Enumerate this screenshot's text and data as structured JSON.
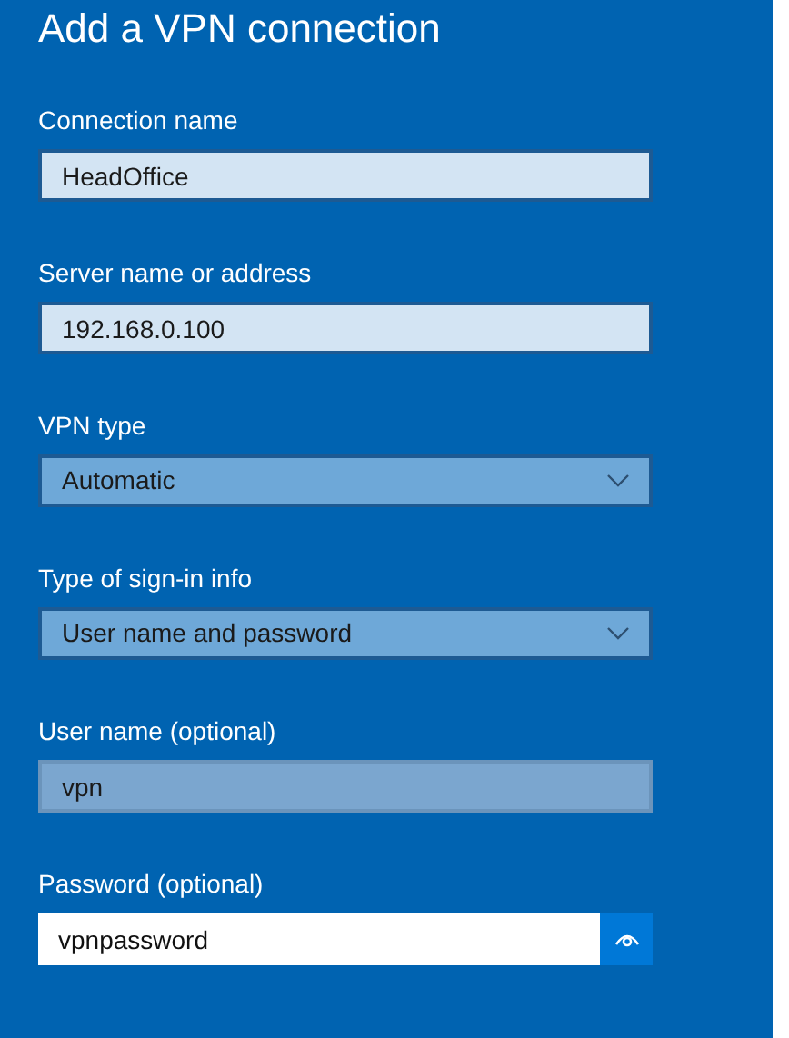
{
  "title": "Add a VPN connection",
  "fields": [
    {
      "label": "Connection name",
      "kind": "text",
      "value": "HeadOffice",
      "highlighted": false,
      "focused": false
    },
    {
      "label": "Server name or address",
      "kind": "text",
      "value": "192.168.0.100",
      "highlighted": false,
      "focused": false
    },
    {
      "label": "VPN type",
      "kind": "dropdown",
      "value": "Automatic",
      "highlighted": false,
      "focused": false
    },
    {
      "label": "Type of sign-in info",
      "kind": "dropdown",
      "value": "User name and password",
      "highlighted": false,
      "focused": false
    },
    {
      "label": "User name (optional)",
      "kind": "text",
      "value": "vpn",
      "highlighted": true,
      "focused": false
    },
    {
      "label": "Password (optional)",
      "kind": "password",
      "value": "vpnpassword",
      "highlighted": false,
      "focused": true
    }
  ]
}
